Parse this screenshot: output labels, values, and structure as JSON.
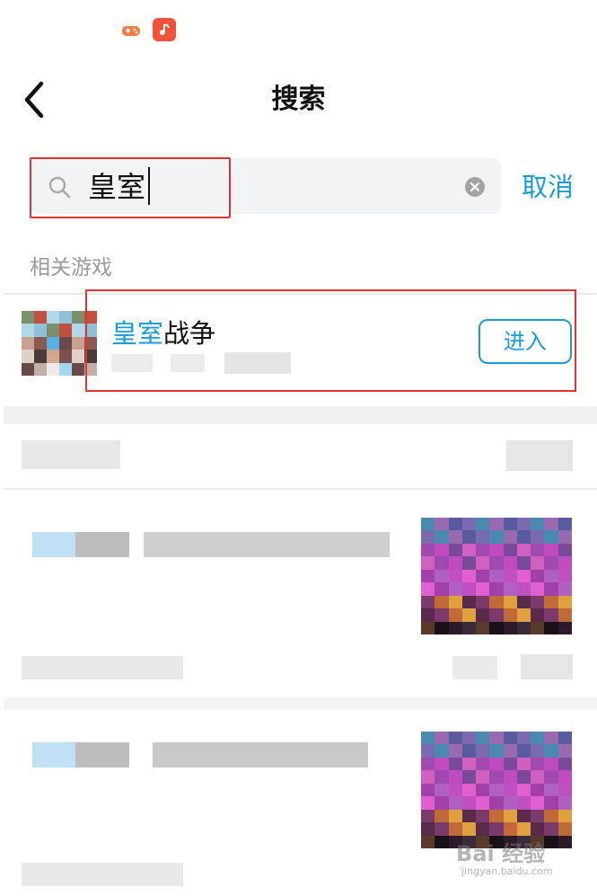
{
  "header": {
    "title": "搜索"
  },
  "search": {
    "query": "皇室",
    "cancel_label": "取消"
  },
  "results": {
    "section_label": "相关游戏",
    "game": {
      "title_highlight": "皇室",
      "title_rest": "战争",
      "action_label": "进入"
    }
  },
  "watermark": {
    "brand": "Bai 经验",
    "url": "jingyan.baidu.com"
  },
  "colors": {
    "accent": "#1a9bdc",
    "highlight_frame": "#e53333",
    "search_bg": "#f2f3f5",
    "section_text": "#9a9a9a"
  }
}
